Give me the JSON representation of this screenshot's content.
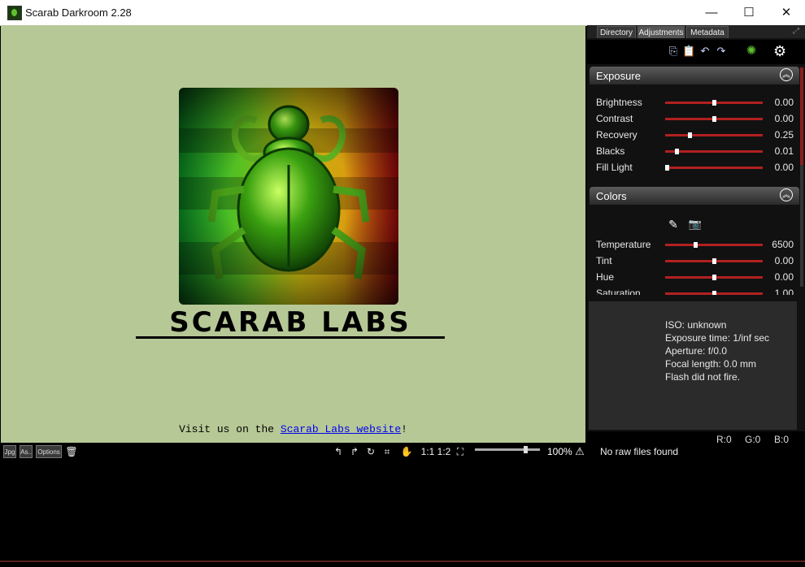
{
  "window": {
    "title": "Scarab Darkroom 2.28",
    "minimize": "—",
    "maximize": "☐",
    "close": "✕"
  },
  "viewer": {
    "logo_text": "SCARAB LABS",
    "visit_prefix": "Visit us on the ",
    "visit_link": "Scarab Labs website",
    "visit_suffix": "!"
  },
  "toolbar": {
    "jpg_label": "Jpg",
    "saveas_label": "As..",
    "options_label": "Options",
    "zoom_1_1": "1:1",
    "zoom_1_2": "1:2",
    "zoom_level": "100%",
    "zoom_slider_value": 0.78
  },
  "panel": {
    "tabs": [
      "Directory",
      "Adjustments",
      "Metadata"
    ],
    "exposure": {
      "title": "Exposure",
      "sliders": [
        {
          "label": "Brightness",
          "value": "0.00",
          "pos": 0.5
        },
        {
          "label": "Contrast",
          "value": "0.00",
          "pos": 0.5
        },
        {
          "label": "Recovery",
          "value": "0.25",
          "pos": 0.25
        },
        {
          "label": "Blacks",
          "value": "0.01",
          "pos": 0.12
        },
        {
          "label": "Fill Light",
          "value": "0.00",
          "pos": 0.02
        }
      ]
    },
    "colors": {
      "title": "Colors",
      "sliders": [
        {
          "label": "Temperature",
          "value": "6500",
          "pos": 0.31
        },
        {
          "label": "Tint",
          "value": "0.00",
          "pos": 0.5
        },
        {
          "label": "Hue",
          "value": "0.00",
          "pos": 0.5
        },
        {
          "label": "Saturation",
          "value": "1.00",
          "pos": 0.5
        }
      ]
    },
    "exif": [
      "ISO: unknown",
      "Exposure time: 1/inf sec",
      "Aperture: f/0.0",
      "Focal length: 0.0 mm",
      "Flash did not fire."
    ],
    "rgb": {
      "r": "R:0",
      "g": "G:0",
      "b": "B:0"
    },
    "status": "No raw files found"
  },
  "colors": {
    "viewer_bg": "#b6c896",
    "slider_red": "#b22020"
  }
}
